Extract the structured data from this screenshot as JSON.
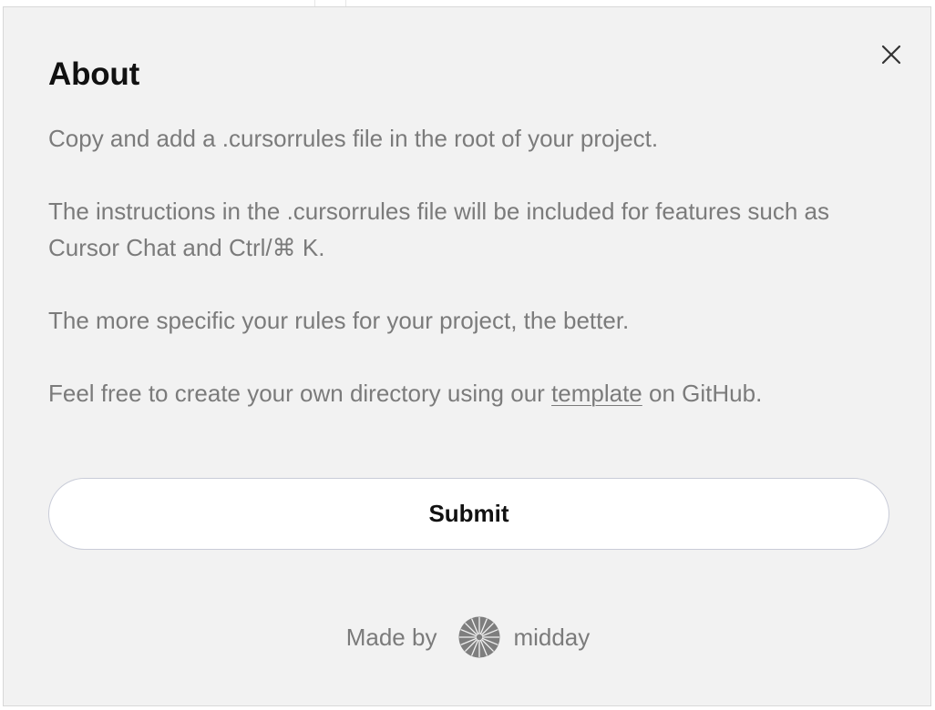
{
  "dialog": {
    "title": "About",
    "close_icon": "close-icon",
    "paragraphs": {
      "p1": "Copy and add a .cursorrules file in the root of your project.",
      "p2": "The instructions in the .cursorrules file will be included for features such as Cursor Chat and Ctrl/⌘ K.",
      "p3": "The more specific your rules for your project, the better.",
      "p4_before": "Feel free to create your own directory using our ",
      "p4_link": "template",
      "p4_after": " on GitHub."
    },
    "submit_label": "Submit",
    "footer": {
      "made_by": "Made by",
      "logo_icon": "midday-logo-icon",
      "brand": "midday"
    }
  },
  "colors": {
    "dialog_bg": "#f2f2f2",
    "title": "#111111",
    "body_text": "#7b7b7b",
    "button_bg": "#ffffff",
    "button_border": "#c9ccd8"
  }
}
